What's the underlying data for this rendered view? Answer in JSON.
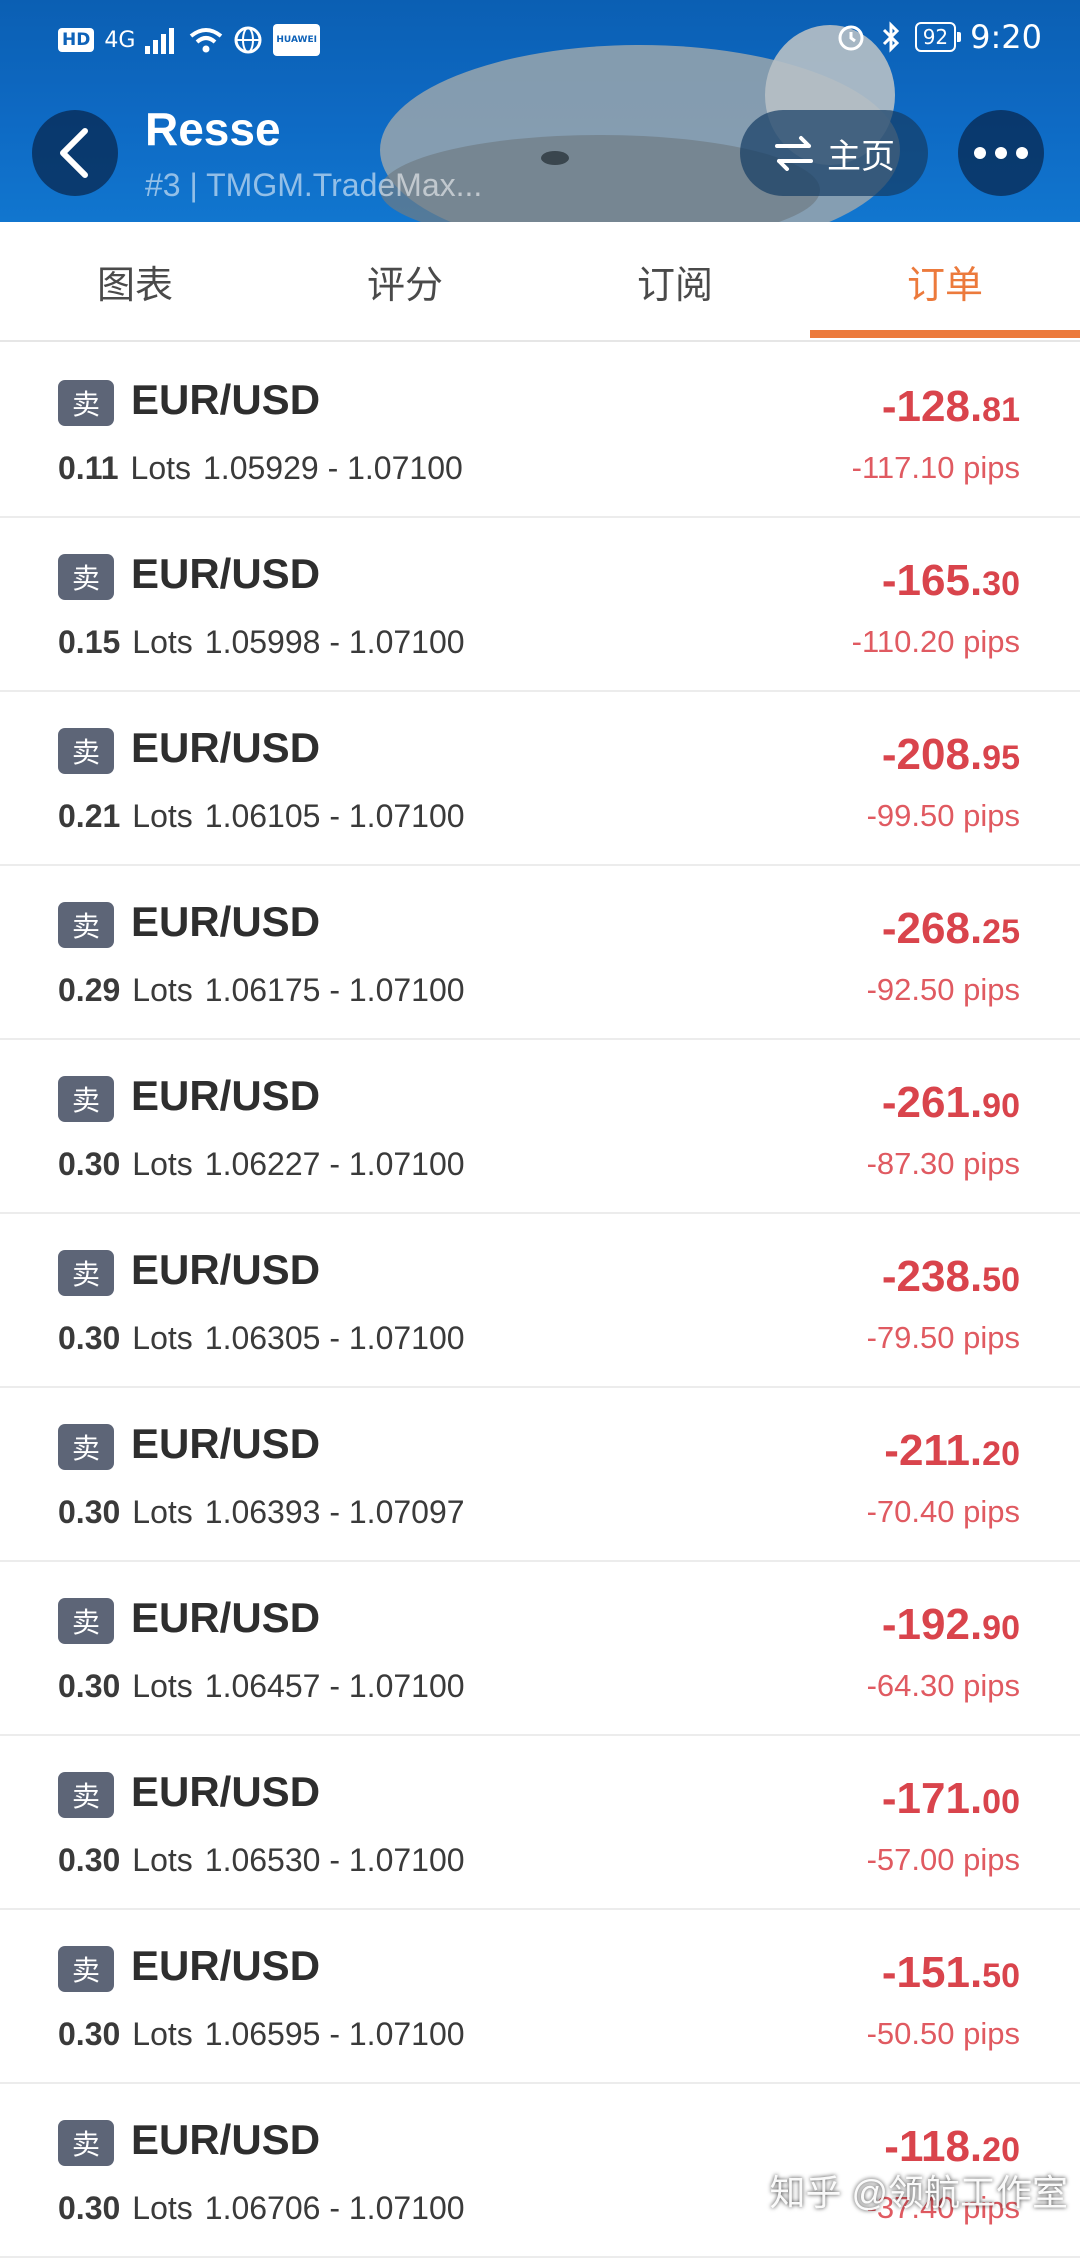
{
  "status_bar": {
    "left_badges": [
      "HD",
      "4G",
      "HUAWEI"
    ],
    "battery": "92",
    "time": "9:20"
  },
  "header": {
    "title": "Resse",
    "subtitle": "#3 | TMGM.TradeMax...",
    "home_label": "主页"
  },
  "tabs": [
    {
      "label": "图表",
      "active": false
    },
    {
      "label": "评分",
      "active": false
    },
    {
      "label": "订阅",
      "active": false
    },
    {
      "label": "订单",
      "active": true
    }
  ],
  "orders": [
    {
      "side": "卖",
      "symbol": "EUR/USD",
      "lots": "0.11",
      "lots_unit": "Lots",
      "open": "1.05929",
      "close": "1.07100",
      "profit_int": "-128.",
      "profit_dec": "81",
      "pips": "-117.10 pips"
    },
    {
      "side": "卖",
      "symbol": "EUR/USD",
      "lots": "0.15",
      "lots_unit": "Lots",
      "open": "1.05998",
      "close": "1.07100",
      "profit_int": "-165.",
      "profit_dec": "30",
      "pips": "-110.20 pips"
    },
    {
      "side": "卖",
      "symbol": "EUR/USD",
      "lots": "0.21",
      "lots_unit": "Lots",
      "open": "1.06105",
      "close": "1.07100",
      "profit_int": "-208.",
      "profit_dec": "95",
      "pips": "-99.50 pips"
    },
    {
      "side": "卖",
      "symbol": "EUR/USD",
      "lots": "0.29",
      "lots_unit": "Lots",
      "open": "1.06175",
      "close": "1.07100",
      "profit_int": "-268.",
      "profit_dec": "25",
      "pips": "-92.50 pips"
    },
    {
      "side": "卖",
      "symbol": "EUR/USD",
      "lots": "0.30",
      "lots_unit": "Lots",
      "open": "1.06227",
      "close": "1.07100",
      "profit_int": "-261.",
      "profit_dec": "90",
      "pips": "-87.30 pips"
    },
    {
      "side": "卖",
      "symbol": "EUR/USD",
      "lots": "0.30",
      "lots_unit": "Lots",
      "open": "1.06305",
      "close": "1.07100",
      "profit_int": "-238.",
      "profit_dec": "50",
      "pips": "-79.50 pips"
    },
    {
      "side": "卖",
      "symbol": "EUR/USD",
      "lots": "0.30",
      "lots_unit": "Lots",
      "open": "1.06393",
      "close": "1.07097",
      "profit_int": "-211.",
      "profit_dec": "20",
      "pips": "-70.40 pips"
    },
    {
      "side": "卖",
      "symbol": "EUR/USD",
      "lots": "0.30",
      "lots_unit": "Lots",
      "open": "1.06457",
      "close": "1.07100",
      "profit_int": "-192.",
      "profit_dec": "90",
      "pips": "-64.30 pips"
    },
    {
      "side": "卖",
      "symbol": "EUR/USD",
      "lots": "0.30",
      "lots_unit": "Lots",
      "open": "1.06530",
      "close": "1.07100",
      "profit_int": "-171.",
      "profit_dec": "00",
      "pips": "-57.00 pips"
    },
    {
      "side": "卖",
      "symbol": "EUR/USD",
      "lots": "0.30",
      "lots_unit": "Lots",
      "open": "1.06595",
      "close": "1.07100",
      "profit_int": "-151.",
      "profit_dec": "50",
      "pips": "-50.50 pips"
    },
    {
      "side": "卖",
      "symbol": "EUR/USD",
      "lots": "0.30",
      "lots_unit": "Lots",
      "open": "1.06706",
      "close": "1.07100",
      "profit_int": "-118.",
      "profit_dec": "20",
      "pips": "-37.40 pips"
    }
  ],
  "watermark": "知乎 @领航工作室",
  "colors": {
    "header_blue": "#0e6ac4",
    "tab_active": "#ec7a3c",
    "loss_red": "#d9444c",
    "sell_badge": "#5d6577"
  }
}
